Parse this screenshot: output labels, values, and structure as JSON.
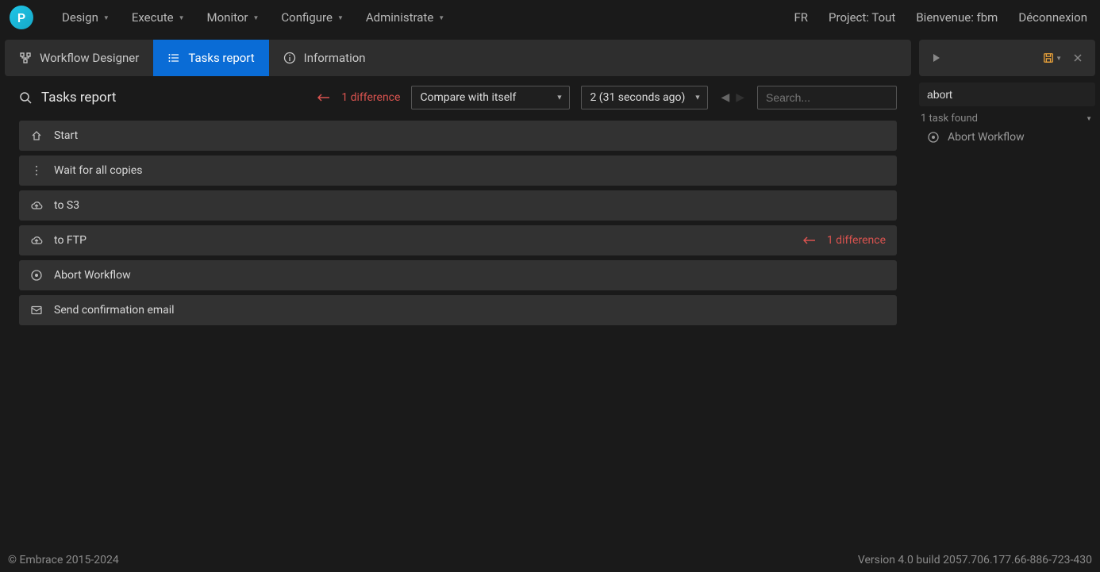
{
  "logo_letter": "P",
  "topnav": {
    "menus": [
      "Design",
      "Execute",
      "Monitor",
      "Configure",
      "Administrate"
    ],
    "right": {
      "lang": "FR",
      "project": "Project: Tout",
      "welcome": "Bienvenue: fbm",
      "logout": "Déconnexion"
    }
  },
  "tabs": [
    {
      "label": "Workflow Designer",
      "icon": "workflow",
      "active": false
    },
    {
      "label": "Tasks report",
      "icon": "list",
      "active": true
    },
    {
      "label": "Information",
      "icon": "info",
      "active": false
    }
  ],
  "toolbar": {
    "title": "Tasks report",
    "diff_count": "1 difference",
    "compare_select": "Compare with itself",
    "run_select": "2 (31 seconds ago)",
    "search_placeholder": "Search..."
  },
  "tasks": [
    {
      "icon": "home",
      "label": "Start"
    },
    {
      "icon": "dots",
      "label": "Wait for all copies"
    },
    {
      "icon": "cloud",
      "label": "to S3"
    },
    {
      "icon": "cloud",
      "label": "to FTP",
      "diff": "1 difference"
    },
    {
      "icon": "target",
      "label": "Abort Workflow"
    },
    {
      "icon": "mail",
      "label": "Send confirmation email"
    }
  ],
  "sidepanel": {
    "search_value": "abort",
    "found_label": "1 task found",
    "results": [
      {
        "icon": "target",
        "label": "Abort Workflow"
      }
    ]
  },
  "footer": {
    "left": "© Embrace 2015-2024",
    "right": "Version 4.0 build 2057.706.177.66-886-723-430"
  }
}
